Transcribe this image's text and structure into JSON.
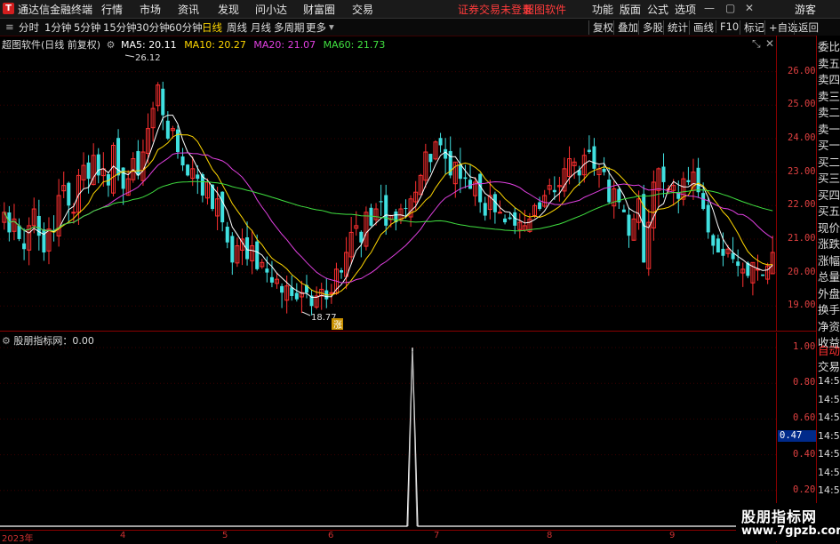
{
  "titlebar": {
    "app_name": "通达信金融终端",
    "menu": [
      "行情",
      "市场",
      "资讯",
      "发现",
      "问小达",
      "财富圈",
      "交易"
    ],
    "warning": "证券交易未登录",
    "brand": "超图软件",
    "right": [
      "功能",
      "版面",
      "公式",
      "选项"
    ],
    "user": "游客"
  },
  "toolbar": {
    "periods": [
      "分时",
      "1分钟",
      "5分钟",
      "15分钟",
      "30分钟",
      "60分钟",
      "日线",
      "周线",
      "月线",
      "多周期",
      "更多"
    ],
    "active_period": "日线",
    "right_buttons": [
      "复权",
      "叠加",
      "多股",
      "统计",
      "画线",
      "F10",
      "标记",
      "+自选",
      "返回"
    ]
  },
  "kline": {
    "stock_label": "超图软件(日线 前复权)",
    "ma": [
      {
        "name": "MA5",
        "value": "20.11",
        "color": "#ffffff"
      },
      {
        "name": "MA10",
        "value": "20.27",
        "color": "#ffd700"
      },
      {
        "name": "MA20",
        "value": "21.07",
        "color": "#e040e0"
      },
      {
        "name": "MA60",
        "value": "21.73",
        "color": "#40e040"
      }
    ],
    "high_label": "26.12",
    "low_label": "18.77",
    "y_ticks": [
      "26.00",
      "25.00",
      "24.00",
      "23.00",
      "22.00",
      "21.00",
      "20.00",
      "19.00"
    ],
    "marker": "涨"
  },
  "indicator": {
    "label": "股朋指标网：0.00",
    "y_ticks": [
      "1.00",
      "0.80",
      "0.60",
      "0.40",
      "0.20"
    ],
    "current": "0.47"
  },
  "x_axis": [
    "2023年",
    "4",
    "5",
    "6",
    "7",
    "8",
    "9"
  ],
  "side_panel": [
    "委比",
    "卖五",
    "卖四",
    "卖三",
    "卖二",
    "卖一",
    "买一",
    "买二",
    "买三",
    "买四",
    "买五",
    "现价",
    "涨跌",
    "涨幅",
    "总量",
    "外盘",
    "换手",
    "净资",
    "收益",
    "自动",
    "交易",
    "14:56",
    "14:56",
    "14:56",
    "14:56",
    "14:56",
    "14:56",
    "14:56",
    "14:56",
    "14:56"
  ],
  "watermark": {
    "line1": "股朋指标网",
    "line2": "www.7gpzb.com"
  },
  "chart_data": {
    "type": "candlestick",
    "note": "",
    "closes": [
      21.8,
      21.2,
      21.6,
      21.0,
      20.7,
      21.4,
      21.9,
      21.1,
      20.6,
      21.3,
      21.2,
      22.3,
      22.6,
      22.0,
      21.8,
      22.9,
      23.2,
      22.8,
      23.5,
      22.9,
      23.1,
      22.6,
      23.8,
      22.9,
      22.5,
      22.8,
      23.4,
      22.9,
      23.6,
      24.3,
      24.9,
      25.6,
      24.7,
      24.0,
      24.3,
      23.6,
      23.2,
      22.9,
      23.1,
      22.8,
      22.3,
      22.7,
      21.9,
      22.2,
      21.5,
      20.9,
      20.3,
      20.8,
      21.0,
      20.4,
      20.8,
      20.1,
      20.3,
      20.0,
      19.7,
      19.8,
      19.4,
      19.6,
      19.3,
      19.2,
      19.4,
      19.4,
      19.0,
      19.3,
      19.5,
      19.2,
      19.4,
      20.1,
      20.0,
      20.6,
      21.2,
      21.4,
      20.9,
      21.8,
      21.4,
      21.9,
      22.1,
      21.4,
      21.7,
      21.5,
      21.9,
      21.9,
      22.2,
      22.4,
      22.9,
      23.6,
      23.3,
      23.9,
      23.8,
      23.4,
      22.9,
      23.3,
      22.8,
      22.8,
      22.5,
      22.7,
      22.1,
      21.7,
      22.3,
      21.8,
      21.8,
      21.5,
      21.6,
      21.4,
      21.5,
      21.4,
      21.6,
      22.0,
      21.9,
      22.3,
      22.6,
      22.4,
      22.6,
      23.1,
      23.4,
      23.3,
      22.9,
      23.5,
      23.6,
      23.1,
      23.1,
      23.0,
      22.1,
      22.5,
      22.1,
      21.8,
      21.1,
      21.6,
      22.2,
      20.3,
      21.5,
      22.7,
      23.1,
      22.7,
      22.5,
      22.6,
      22.2,
      22.8,
      22.7,
      23.0,
      22.4,
      21.9,
      21.2,
      20.8,
      20.6,
      20.5,
      20.7,
      20.4,
      20.2,
      20.1,
      19.9,
      20.3,
      20.1,
      19.9,
      20.2,
      20.6
    ]
  },
  "colors": {
    "up": "#ff3030",
    "down": "#40e0e0",
    "grid": "#8b0000",
    "ma5": "#ffffff",
    "ma10": "#ffd700",
    "ma20": "#e040e0",
    "ma60": "#40e040",
    "spike": "#ffffff"
  }
}
